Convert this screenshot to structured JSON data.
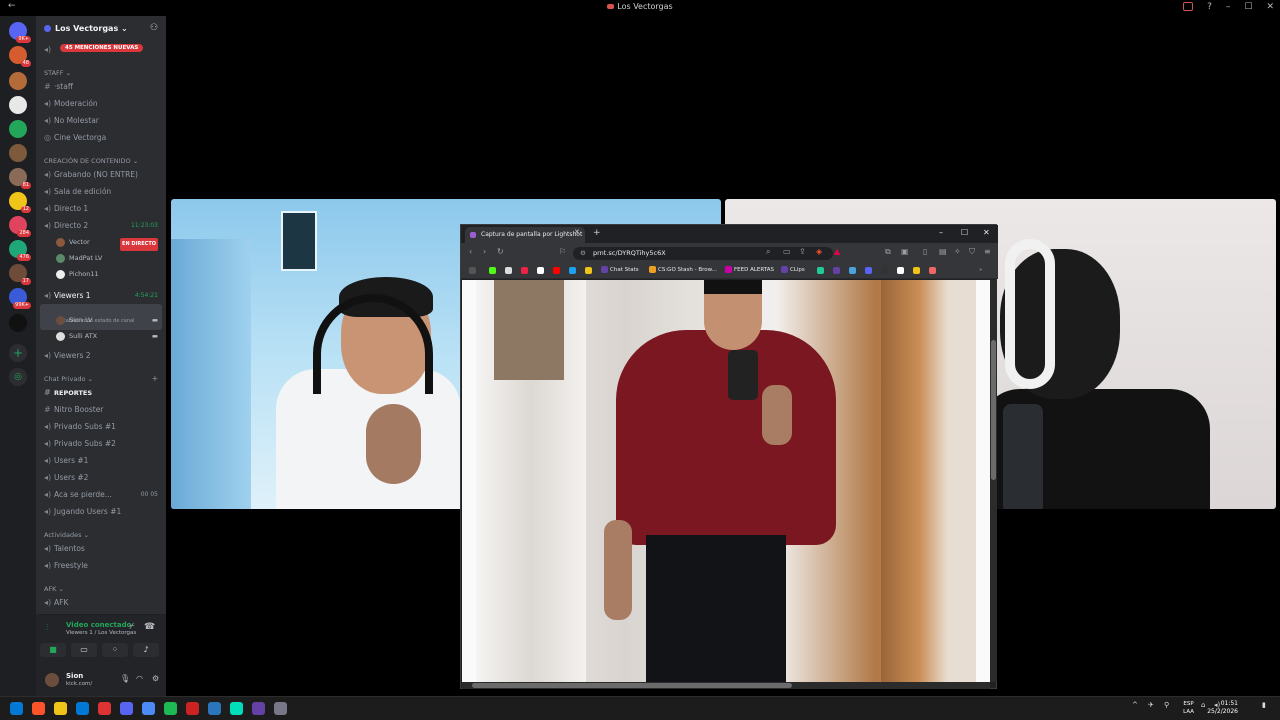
{
  "window": {
    "title": "Los Vectorgas"
  },
  "server": {
    "name": "Los Vectorgas",
    "mentions": "45 MENCIONES NUEVAS"
  },
  "server_rail": {
    "badges": [
      "9K+",
      "48",
      "81",
      "12",
      "284",
      "476",
      "17",
      "99K+"
    ]
  },
  "channels": {
    "staff_category": "STAFF",
    "staff": [
      "·staff",
      "Moderación",
      "No Molestar",
      "Cine Vectorga"
    ],
    "content_category": "CREACIÓN DE CONTENIDO",
    "content": [
      "Grabando (NO ENTRE)",
      "Sala de edición",
      "Directo 1",
      "Directo 2"
    ],
    "directo2_timer": "11:23:03",
    "directo2_users": [
      {
        "name": "Vector",
        "badge": "EN DIRECTO"
      },
      {
        "name": "MadPat",
        "badge": "LV"
      },
      {
        "name": "Pichon11",
        "badge": ""
      }
    ],
    "viewers1": "Viewers 1",
    "viewers1_timer": "4:54:21",
    "viewers1_status": "Estableciendo estado de canal",
    "viewers1_users": [
      {
        "name": "Sion",
        "badge": "LV"
      },
      {
        "name": "Sulli",
        "badge": "ATX"
      }
    ],
    "viewers2": "Viewers 2",
    "private_category": "Chat Privado",
    "private": [
      "REPORTES",
      "Nitro Booster",
      "Privado Subs #1",
      "Privado Subs #2",
      "Users #1",
      "Users #2",
      "Aca se pierde...",
      "Jugando Users #1"
    ],
    "aca_counts": [
      "00",
      "05"
    ],
    "activities_category": "Actividades",
    "activities": [
      "Talentos",
      "Freestyle"
    ],
    "afk_category": "AFK",
    "afk": [
      "AFK"
    ]
  },
  "voice": {
    "status": "Video conectado",
    "channel": "Viewers 1 / Los Vectorgas"
  },
  "user": {
    "name": "Sion",
    "status": "kick.com/"
  },
  "browser": {
    "tab_title": "Captura de pantalla por Lightshot",
    "url": "prnt.sc/DYRQTihy5c6X",
    "bookmarks": [
      "Chat Stats",
      "CS:GO Stash - Brow...",
      "FEED ALERTAS",
      "CLips"
    ]
  },
  "taskbar": {
    "lang": "ESP",
    "lang_sub": "LAA",
    "time": "01:51",
    "date": "25/2/2026"
  }
}
